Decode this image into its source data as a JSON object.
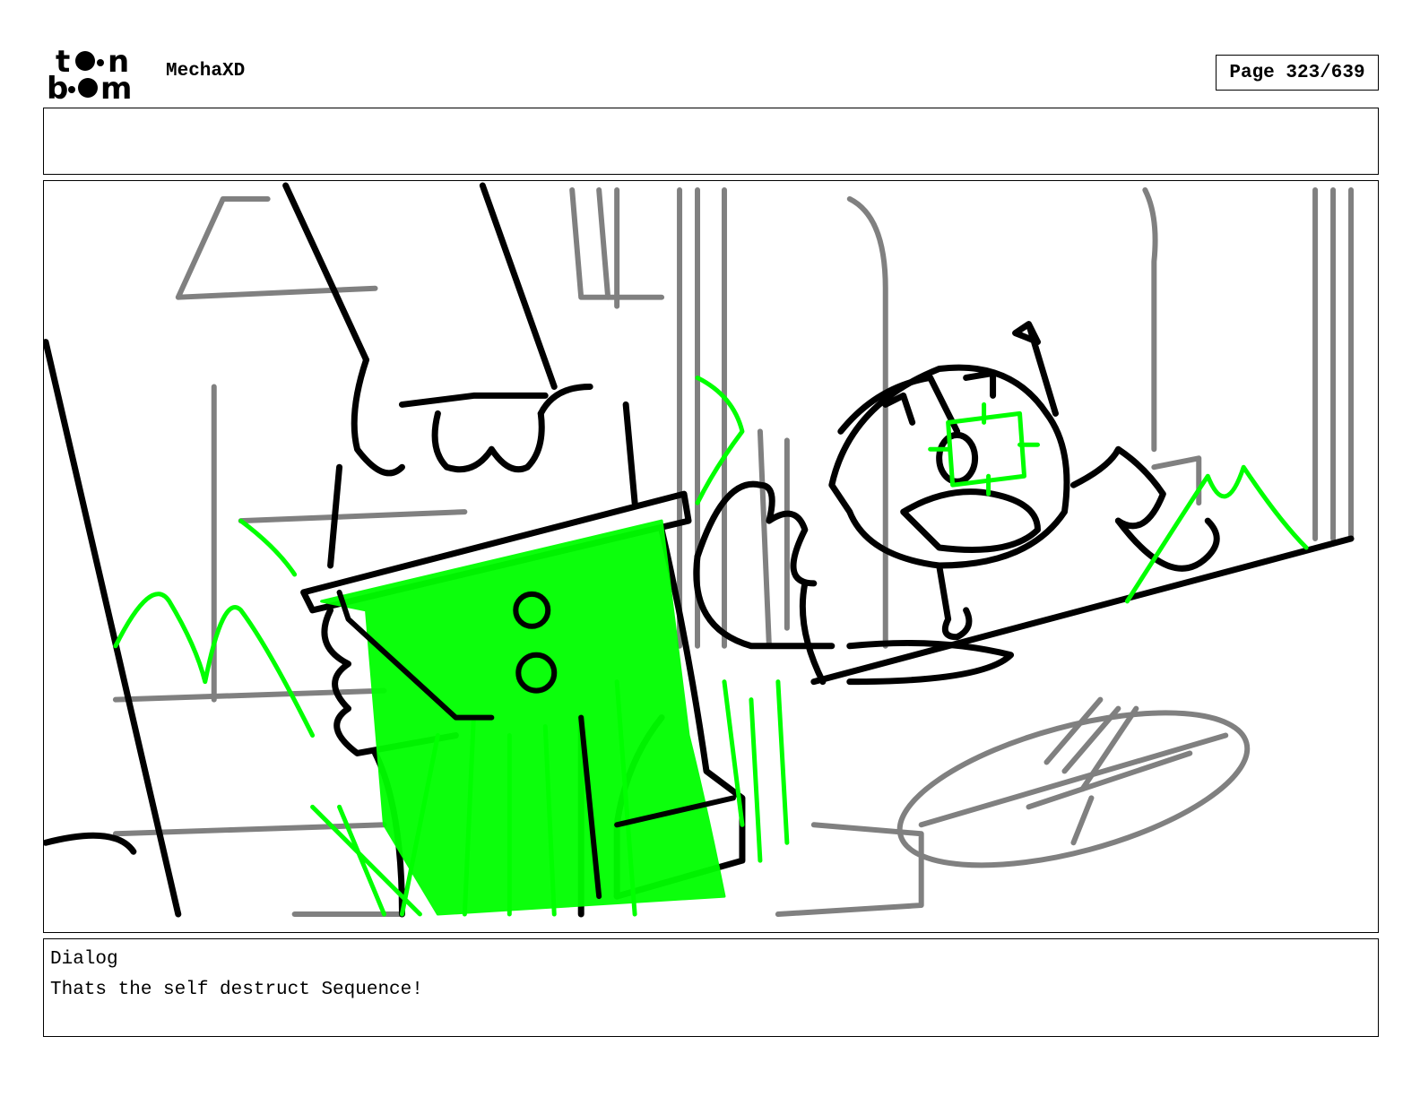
{
  "header": {
    "logo": {
      "top_word": "toon",
      "bottom_word": "boom"
    },
    "project_title": "MechaXD",
    "page_indicator": "Page 323/639"
  },
  "panel": {
    "ink_color": "#000000",
    "rough_color": "#808080",
    "fx_color": "#00ff00"
  },
  "dialog": {
    "label": "Dialog",
    "text": "Thats the self destruct Sequence!"
  }
}
